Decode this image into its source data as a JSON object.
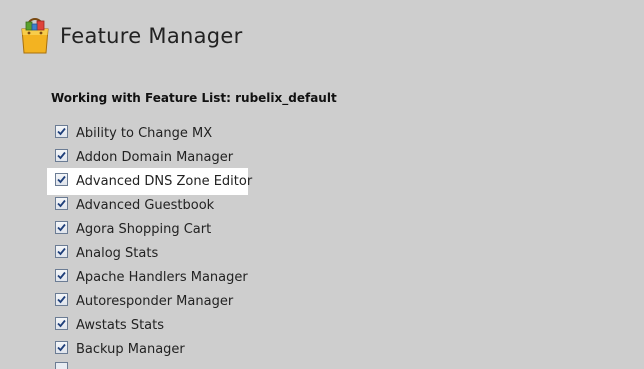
{
  "header": {
    "title": "Feature Manager",
    "icon": "shopping-bag-icon"
  },
  "subtitle": "Working with Feature List: rubelix_default",
  "features": [
    {
      "label": "Ability to Change MX",
      "checked": true
    },
    {
      "label": "Addon Domain Manager",
      "checked": true
    },
    {
      "label": "Advanced DNS Zone Editor",
      "checked": true,
      "highlighted": true
    },
    {
      "label": "Advanced Guestbook",
      "checked": true
    },
    {
      "label": "Agora Shopping Cart",
      "checked": true
    },
    {
      "label": "Analog Stats",
      "checked": true
    },
    {
      "label": "Apache Handlers Manager",
      "checked": true
    },
    {
      "label": "Autoresponder Manager",
      "checked": true
    },
    {
      "label": "Awstats Stats",
      "checked": true
    },
    {
      "label": "Backup Manager",
      "checked": true
    }
  ],
  "colors": {
    "background": "#cecece",
    "highlight": "#ffffff",
    "checkmark": "#1f3f7a"
  }
}
